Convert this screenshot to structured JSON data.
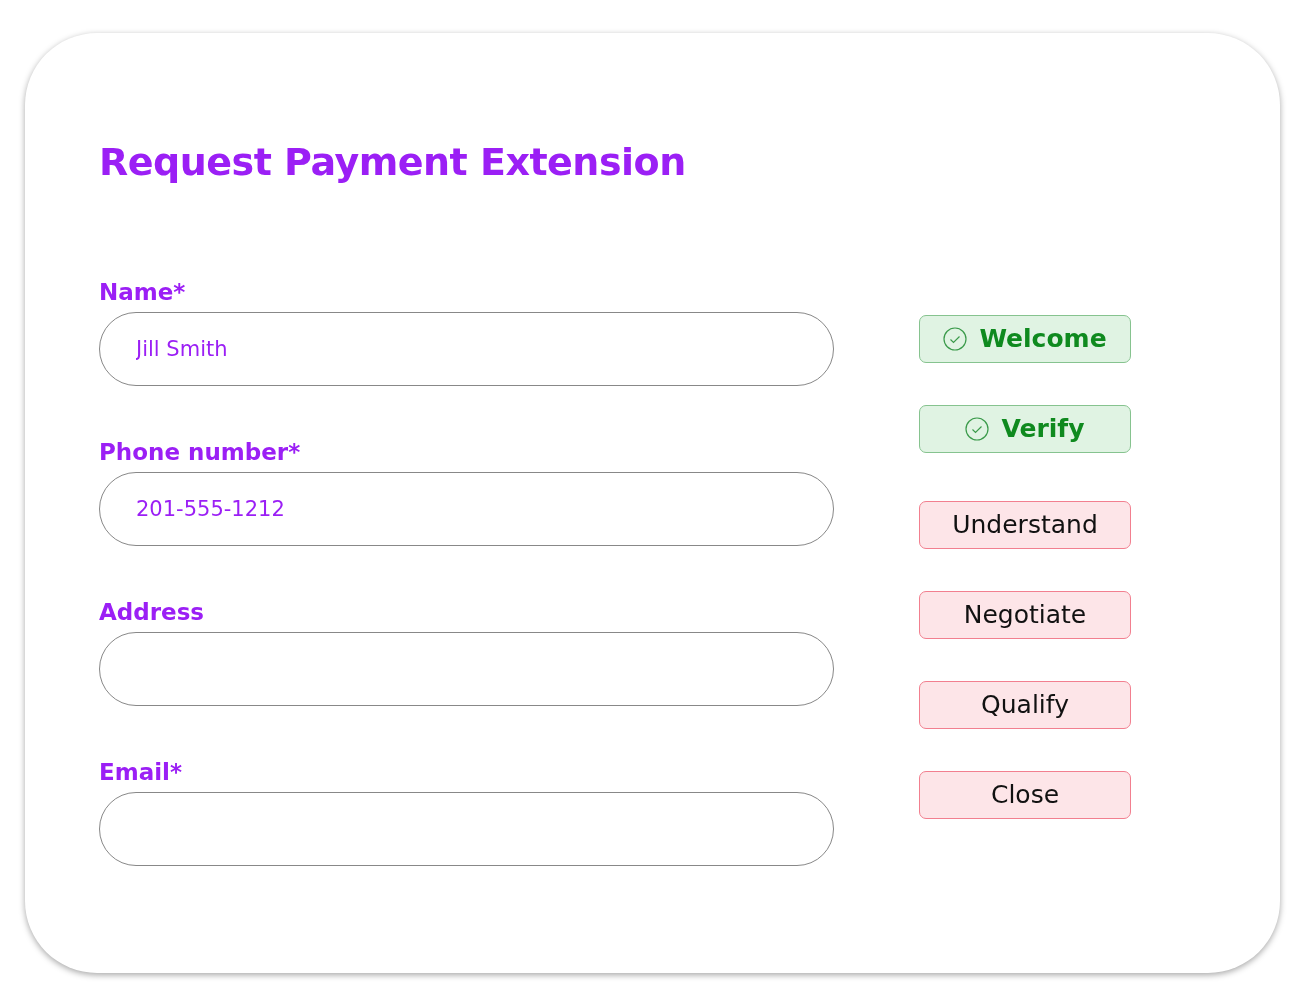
{
  "title": "Request Payment Extension",
  "fields": [
    {
      "label": "Name*",
      "value": "Jill Smith"
    },
    {
      "label": "Phone number*",
      "value": "201-555-1212"
    },
    {
      "label": "Address"
    },
    {
      "label": "Email*"
    }
  ],
  "steps": [
    {
      "label": "Welcome",
      "completed": true
    },
    {
      "label": "Verify",
      "completed": true
    },
    {
      "label": "Understand",
      "completed": false
    },
    {
      "label": "Negotiate",
      "completed": false
    },
    {
      "label": "Qualify",
      "completed": false
    },
    {
      "label": "Close",
      "completed": false
    }
  ]
}
